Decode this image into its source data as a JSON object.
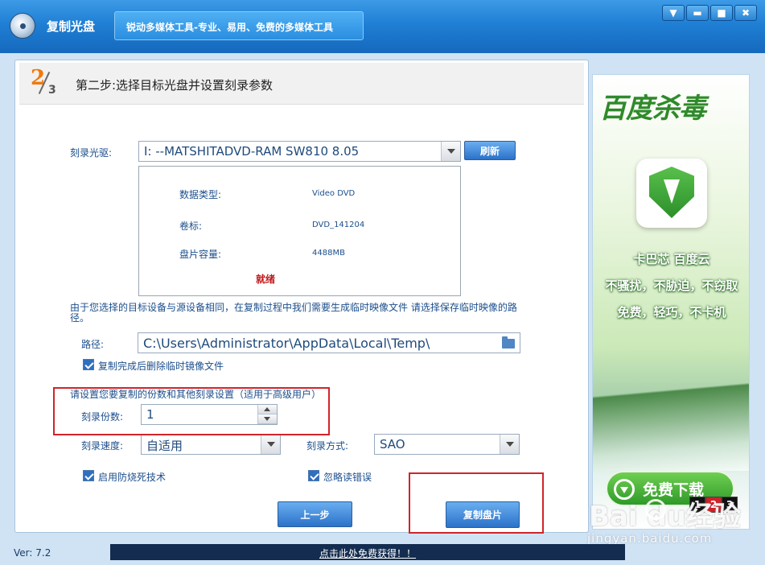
{
  "window": {
    "title": "复制光盘",
    "slogan": "锐动多媒体工具-专业、易用、免费的多媒体工具",
    "controls": {
      "down": "▼",
      "minimize": "▬",
      "maximize": "■",
      "close": "✖"
    }
  },
  "step": {
    "current": "2",
    "total": "3",
    "title": "第二步:选择目标光盘并设置刻录参数"
  },
  "drive": {
    "label": "刻录光驱:",
    "value": "I:  --MATSHITADVD-RAM SW810    8.05",
    "refresh_label": "刷新"
  },
  "disc_info": {
    "type_label": "数据类型:",
    "type_value": "Video DVD",
    "volume_label": "卷标:",
    "volume_value": "DVD_141204",
    "capacity_label": "盘片容量:",
    "capacity_value": "4488MB",
    "status": "就绪"
  },
  "temp_notice": "由于您选择的目标设备与源设备相同，在复制过程中我们需要生成临时映像文件 请选择保存临时映像的路径。",
  "path": {
    "label": "路径:",
    "value": "C:\\Users\\Administrator\\AppData\\Local\\Temp\\"
  },
  "delete_temp": {
    "label": "复制完成后删除临时镜像文件",
    "checked": true
  },
  "advanced_notice": "请设置您要复制的份数和其他刻录设置（适用于高级用户）",
  "copies": {
    "label": "刻录份数:",
    "value": "1"
  },
  "speed": {
    "label": "刻录速度:",
    "value": "自适用"
  },
  "mode": {
    "label": "刻录方式:",
    "value": "SAO"
  },
  "burnproof": {
    "label": "启用防烧死技术",
    "checked": true
  },
  "ignore_errors": {
    "label": "忽略读错误",
    "checked": true
  },
  "buttons": {
    "back": "上一步",
    "copy": "复制盘片"
  },
  "ad": {
    "brand": "百度杀毒",
    "line1": "卡巴芯  百度云",
    "line2": "不骚扰，不胁迫，不窃取",
    "line3": "免费，轻巧，不卡机",
    "download": "免费下载",
    "pages": [
      "1",
      "2",
      "3"
    ],
    "active_page": "2"
  },
  "watermark": {
    "logo": "Bai  du经验",
    "url": "jingyan.baidu.com"
  },
  "footer": {
    "version": "Ver: 7.2",
    "promo": "点击此处免费获得！！"
  },
  "colors": {
    "accent": "#2b72c9",
    "title_bar": "#1f7fd4",
    "status_red": "#c0171a",
    "highlight_box": "#d0252a",
    "step_orange": "#f07a0c"
  }
}
